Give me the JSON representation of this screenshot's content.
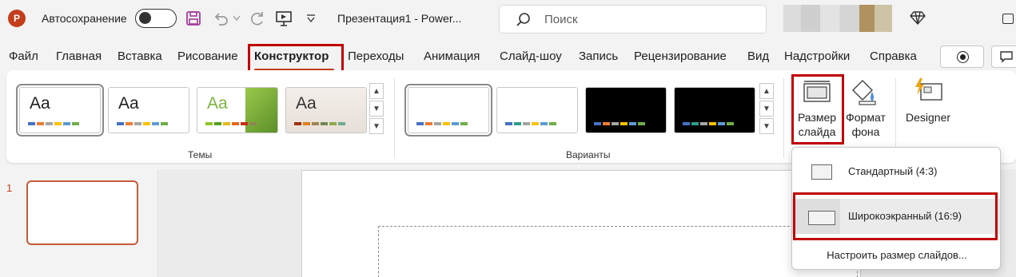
{
  "titlebar": {
    "app_icon_letter": "P",
    "autosave_label": "Автосохранение",
    "doc_title": "Презентация1 - Power...",
    "search_placeholder": "Поиск"
  },
  "tabs": [
    {
      "label": "Файл"
    },
    {
      "label": "Главная"
    },
    {
      "label": "Вставка"
    },
    {
      "label": "Рисование"
    },
    {
      "label": "Конструктор"
    },
    {
      "label": "Переходы"
    },
    {
      "label": "Анимация"
    },
    {
      "label": "Слайд-шоу"
    },
    {
      "label": "Запись"
    },
    {
      "label": "Рецензирование"
    },
    {
      "label": "Вид"
    },
    {
      "label": "Надстройки"
    },
    {
      "label": "Справка"
    }
  ],
  "ribbon": {
    "themes_group_label": "Темы",
    "variants_group_label": "Варианты",
    "theme_sample_text": "Aa",
    "slide_size_label_1": "Размер",
    "slide_size_label_2": "слайда",
    "format_bg_label_1": "Формат",
    "format_bg_label_2": "фона",
    "designer_label": "Designer"
  },
  "slide_pane": {
    "slide_number": "1"
  },
  "dropdown": {
    "standard": "Стандартный (4:3)",
    "widescreen": "Широкоэкранный (16:9)",
    "custom": "Настроить размер слайдов..."
  },
  "colors": {
    "accent": "#c43e1c",
    "highlight_box": "#c00000"
  }
}
